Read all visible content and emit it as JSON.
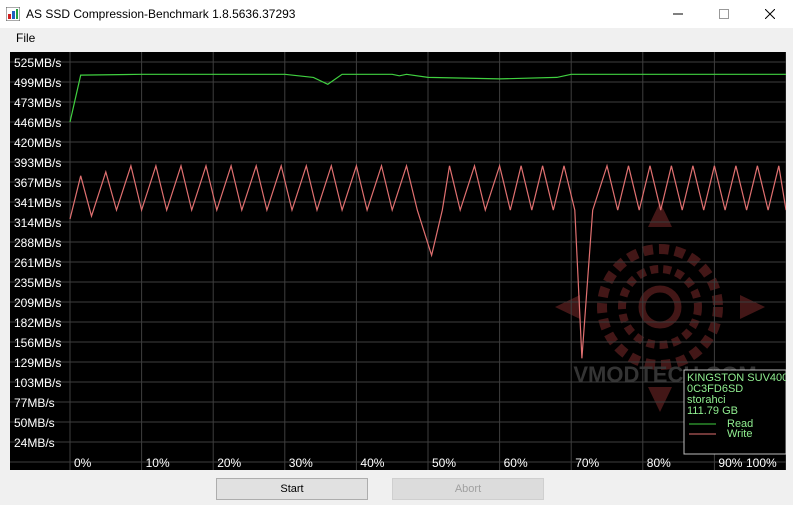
{
  "window": {
    "title": "AS SSD Compression-Benchmark 1.8.5636.37293",
    "minimize_icon": "minimize-icon",
    "maximize_icon": "maximize-icon",
    "close_icon": "close-icon"
  },
  "menu": {
    "file": "File"
  },
  "buttons": {
    "start": "Start",
    "abort": "Abort"
  },
  "device": {
    "lines": [
      "KINGSTON SUV400",
      "0C3FD6SD",
      "storahci",
      "111.79 GB"
    ]
  },
  "watermark": "VMODTECH.COM",
  "colors": {
    "read": "#40d040",
    "write": "#e07070",
    "background": "#000000",
    "grid": "#3e3e3e"
  },
  "chart_data": {
    "type": "line",
    "xlabel": "",
    "ylabel": "",
    "x_ticks": [
      "0%",
      "10%",
      "20%",
      "30%",
      "40%",
      "50%",
      "60%",
      "70%",
      "80%",
      "90%",
      "100%"
    ],
    "y_ticks": [
      "525MB/s",
      "499MB/s",
      "473MB/s",
      "446MB/s",
      "420MB/s",
      "393MB/s",
      "367MB/s",
      "341MB/s",
      "314MB/s",
      "288MB/s",
      "261MB/s",
      "235MB/s",
      "209MB/s",
      "182MB/s",
      "156MB/s",
      "129MB/s",
      "103MB/s",
      "77MB/s",
      "50MB/s",
      "24MB/s"
    ],
    "xlim": [
      0,
      100
    ],
    "ylim": [
      0,
      538
    ],
    "grid": true,
    "legend_position": "bottom-right",
    "series": [
      {
        "name": "Read",
        "color": "#40d040",
        "points": [
          [
            0,
            446
          ],
          [
            1.5,
            508
          ],
          [
            10,
            509
          ],
          [
            20,
            509
          ],
          [
            30,
            509
          ],
          [
            34,
            505
          ],
          [
            36,
            496
          ],
          [
            38,
            509
          ],
          [
            45,
            509
          ],
          [
            46,
            507
          ],
          [
            47,
            509
          ],
          [
            50,
            505
          ],
          [
            60,
            503
          ],
          [
            68,
            505
          ],
          [
            70,
            509
          ],
          [
            80,
            509
          ],
          [
            90,
            509
          ],
          [
            100,
            509
          ]
        ]
      },
      {
        "name": "Write",
        "color": "#e07070",
        "points": [
          [
            0,
            318
          ],
          [
            1.5,
            375
          ],
          [
            3,
            322
          ],
          [
            5,
            380
          ],
          [
            6.5,
            330
          ],
          [
            8.5,
            388
          ],
          [
            10,
            330
          ],
          [
            12,
            388
          ],
          [
            13.5,
            330
          ],
          [
            15.5,
            388
          ],
          [
            17,
            330
          ],
          [
            19,
            388
          ],
          [
            20.5,
            330
          ],
          [
            22.5,
            388
          ],
          [
            24,
            330
          ],
          [
            26,
            388
          ],
          [
            27.5,
            330
          ],
          [
            29.5,
            388
          ],
          [
            31,
            330
          ],
          [
            33,
            388
          ],
          [
            34.5,
            330
          ],
          [
            36.5,
            388
          ],
          [
            38,
            330
          ],
          [
            40,
            388
          ],
          [
            41.5,
            330
          ],
          [
            43.5,
            388
          ],
          [
            45,
            330
          ],
          [
            47,
            388
          ],
          [
            48.5,
            330
          ],
          [
            50.5,
            270
          ],
          [
            52,
            330
          ],
          [
            53,
            388
          ],
          [
            54.5,
            330
          ],
          [
            56.5,
            388
          ],
          [
            58,
            330
          ],
          [
            60,
            388
          ],
          [
            61.5,
            330
          ],
          [
            63,
            388
          ],
          [
            64.5,
            330
          ],
          [
            66,
            388
          ],
          [
            67.5,
            330
          ],
          [
            69,
            388
          ],
          [
            70.5,
            330
          ],
          [
            71.5,
            134
          ],
          [
            73,
            330
          ],
          [
            75,
            388
          ],
          [
            76.5,
            330
          ],
          [
            78,
            388
          ],
          [
            79.5,
            330
          ],
          [
            81,
            388
          ],
          [
            82.5,
            330
          ],
          [
            84,
            388
          ],
          [
            85.5,
            330
          ],
          [
            87,
            388
          ],
          [
            88.5,
            330
          ],
          [
            90,
            388
          ],
          [
            91.5,
            330
          ],
          [
            93,
            388
          ],
          [
            94.5,
            330
          ],
          [
            96,
            388
          ],
          [
            97.5,
            330
          ],
          [
            99,
            388
          ],
          [
            100,
            330
          ]
        ]
      }
    ]
  }
}
